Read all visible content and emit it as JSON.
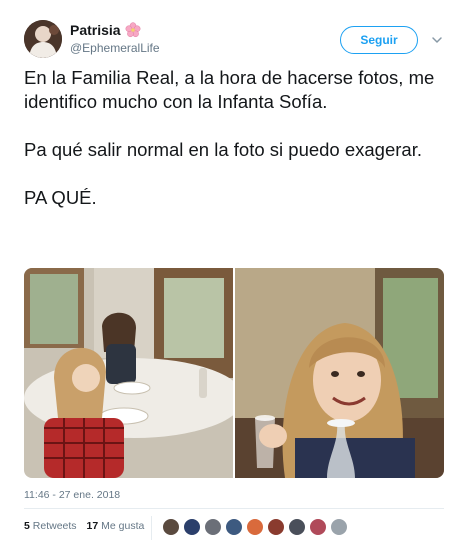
{
  "user": {
    "display_name": "Patrisia",
    "handle": "@EphemeralLife",
    "emoji_icon": "cherry-blossom-icon"
  },
  "follow_label": "Seguir",
  "tweet": {
    "paragraphs": [
      "En la Familia Real, a la hora de hacerse fotos, me identifico mucho con la Infanta Sofía.",
      "Pa qué salir normal en la foto si puedo exagerar.",
      "PA QUÉ."
    ]
  },
  "timestamp": "11:46 - 27 ene. 2018",
  "stats": {
    "retweets_count": "5",
    "retweets_label": "Retweets",
    "likes_count": "17",
    "likes_label": "Me gusta"
  },
  "likers": [
    {
      "color": "#5a4a3f"
    },
    {
      "color": "#2b3f6b"
    },
    {
      "color": "#6b6f78"
    },
    {
      "color": "#3d5a80"
    },
    {
      "color": "#d96a3c"
    },
    {
      "color": "#8a3b2e"
    },
    {
      "color": "#4a4f5a"
    },
    {
      "color": "#b04a5a"
    },
    {
      "color": "#9aa3ab"
    }
  ],
  "colors": {
    "accent": "#1da1f2",
    "text": "#14171a",
    "secondary": "#657786"
  }
}
